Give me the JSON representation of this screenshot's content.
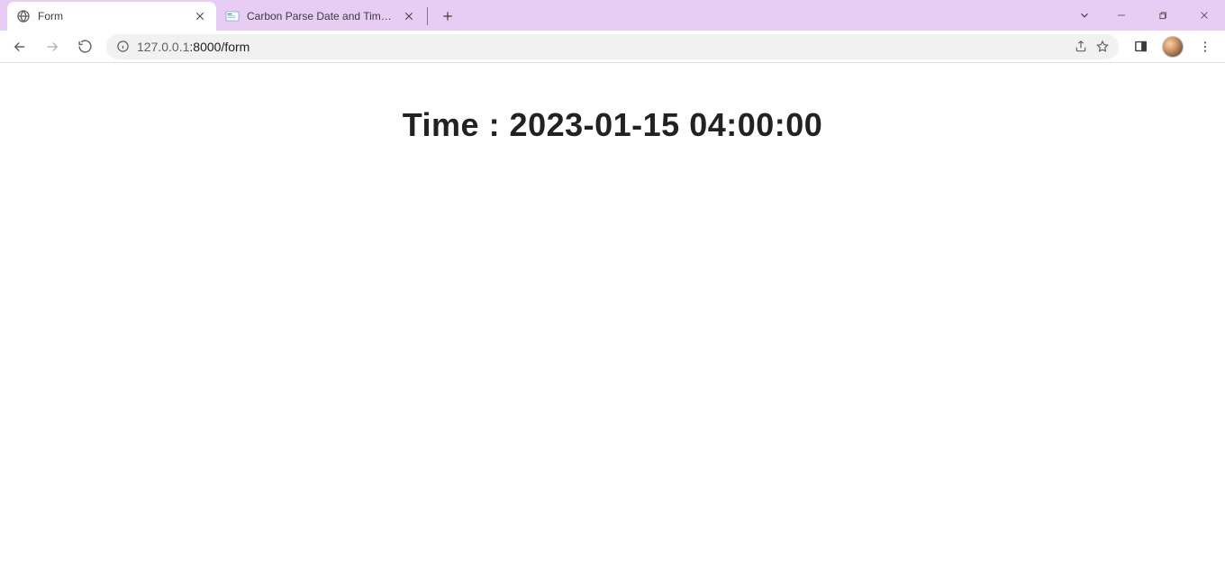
{
  "window": {
    "tabs": [
      {
        "title": "Form",
        "active": true
      },
      {
        "title": "Carbon Parse Date and Time In L",
        "active": false
      }
    ]
  },
  "toolbar": {
    "url_host": "127.0.0.1",
    "url_port": ":8000",
    "url_path": "/form"
  },
  "page": {
    "headline": "Time : 2023-01-15 04:00:00"
  }
}
